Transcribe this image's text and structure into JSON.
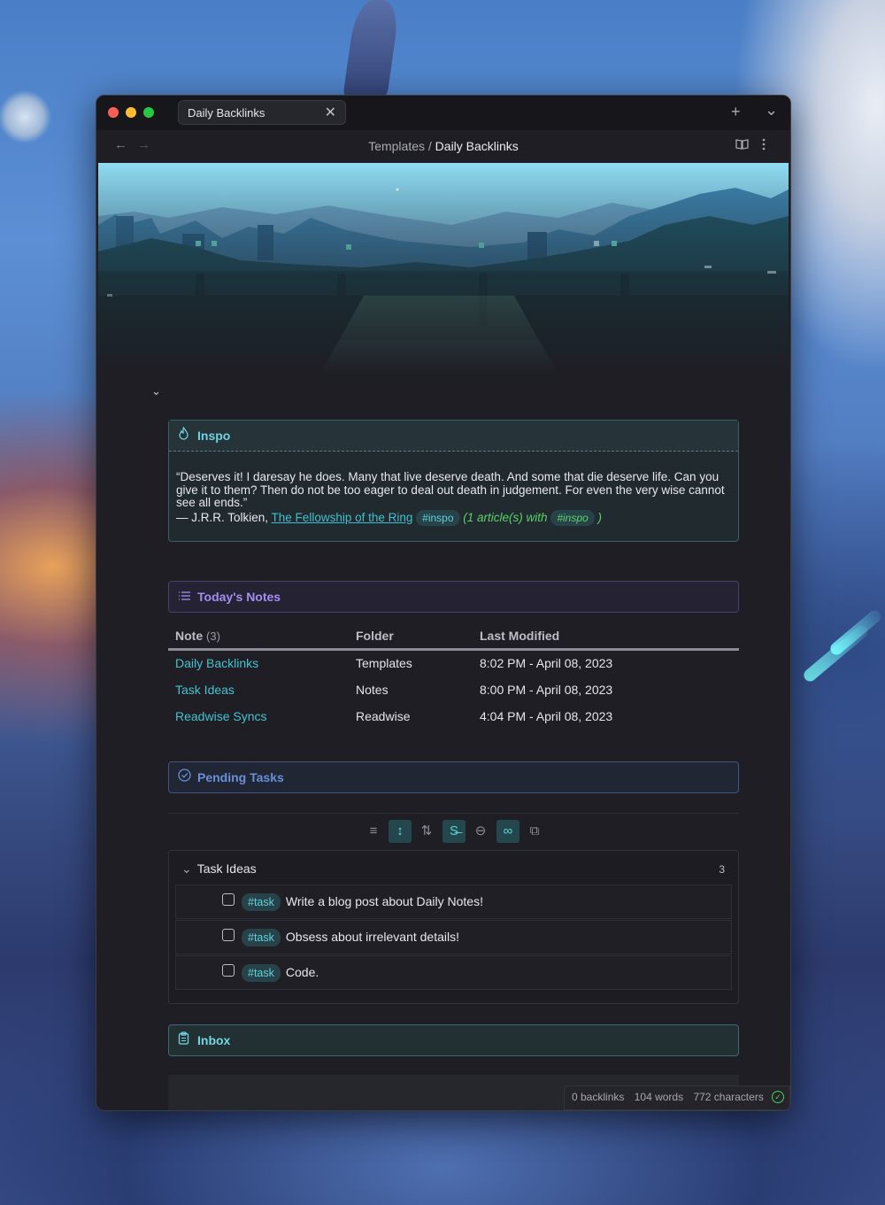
{
  "window": {
    "tab_title": "Daily Backlinks",
    "tab_close": "✕",
    "new_tab": "+",
    "tab_menu": "⌄"
  },
  "nav": {
    "back": "←",
    "forward": "→",
    "breadcrumb_parent": "Templates",
    "breadcrumb_sep": " / ",
    "breadcrumb_current": "Daily Backlinks"
  },
  "inspo": {
    "title": "Inspo",
    "quote": "“Deserves it! I daresay he does. Many that live deserve death. And some that die deserve life. Can you give it to them? Then do not be too eager to deal out death in judgement. For even the very wise cannot see all ends.”",
    "attribution": "— J.R.R. Tolkien, ",
    "book": "The Fellowship of the Ring",
    "tag": "#inspo",
    "count_text_pre": "(1 article(s) with",
    "count_tag": "#inspo",
    "count_text_post": ")"
  },
  "todays_notes": {
    "title": "Today's Notes",
    "columns": {
      "note": "Note",
      "note_count": "(3)",
      "folder": "Folder",
      "modified": "Last Modified"
    },
    "rows": [
      {
        "note": "Daily Backlinks",
        "folder": "Templates",
        "modified": "8:02 PM - April 08, 2023"
      },
      {
        "note": "Task Ideas",
        "folder": "Notes",
        "modified": "8:00 PM - April 08, 2023"
      },
      {
        "note": "Readwise Syncs",
        "folder": "Readwise",
        "modified": "4:04 PM - April 08, 2023"
      }
    ]
  },
  "pending": {
    "title": "Pending Tasks",
    "group": {
      "name": "Task Ideas",
      "count": "3"
    },
    "tasks": [
      {
        "tag": "#task",
        "text": "Write a blog post about Daily Notes!"
      },
      {
        "tag": "#task",
        "text": "Obsess about irrelevant details!"
      },
      {
        "tag": "#task",
        "text": "Code."
      }
    ]
  },
  "inbox": {
    "title": "Inbox"
  },
  "status": {
    "backlinks": "0 backlinks",
    "words": "104 words",
    "characters": "772 characters"
  },
  "colors": {
    "accent_teal": "#46c2d2",
    "accent_purple": "#a58ef2",
    "accent_blue": "#6a8fd8",
    "green": "#5bd36a"
  }
}
